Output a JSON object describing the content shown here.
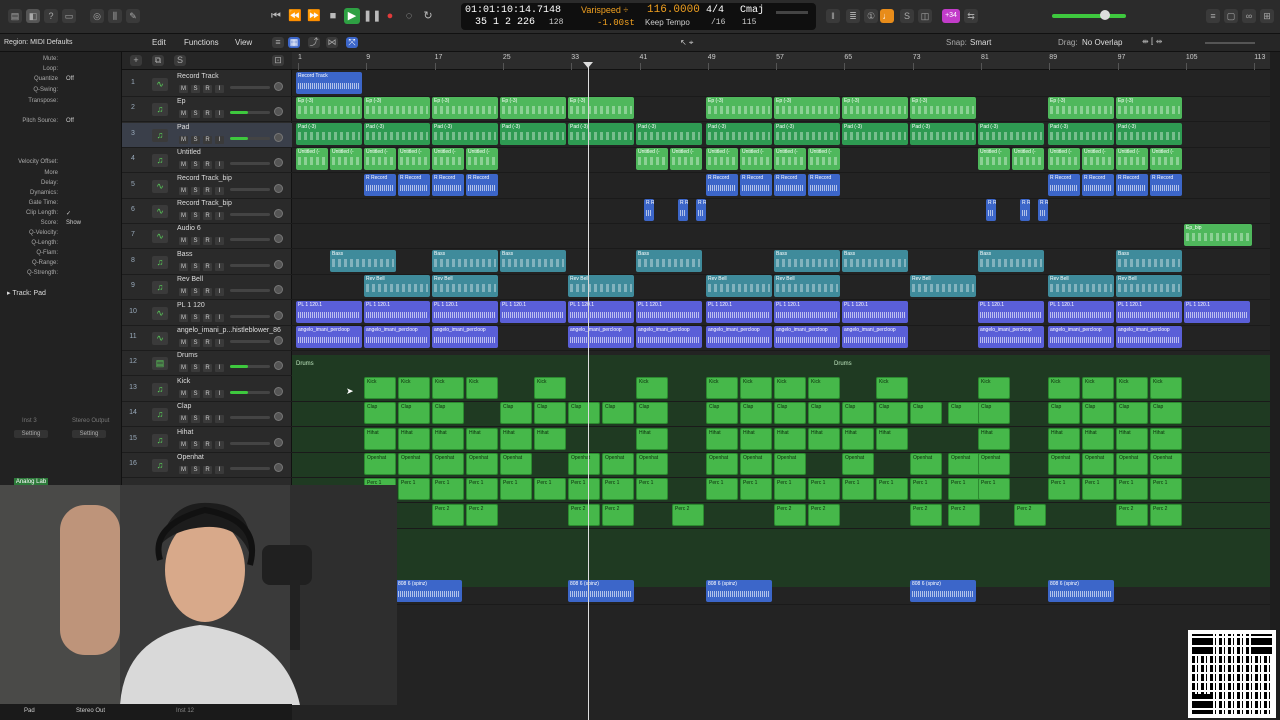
{
  "lcd": {
    "time": "01:01:10:14.71",
    "bars": "35  1  2  226",
    "div": "48",
    "div2": "128",
    "varispeed": "Varispeed ÷",
    "varispeed_val": "-1.00st",
    "tempo": "116.0000",
    "keep_tempo": "Keep Tempo",
    "sig": "4/4",
    "sig_div": "/16",
    "key": "Cmaj",
    "key_val": "115"
  },
  "toolbar": {
    "region_label": "Region: MIDI Defaults",
    "edit": "Edit",
    "functions": "Functions",
    "view": "View",
    "snap_label": "Snap:",
    "snap_value": "Smart",
    "drag_label": "Drag:",
    "drag_value": "No Overlap",
    "badge": "+34"
  },
  "inspector": {
    "rows": [
      {
        "label": "Mute:",
        "value": ""
      },
      {
        "label": "Loop:",
        "value": ""
      },
      {
        "label": "Quantize",
        "value": "Off"
      },
      {
        "label": "Q-Swing:",
        "value": ""
      },
      {
        "label": "Transpose:",
        "value": ""
      },
      {
        "label": "Pitch Source:",
        "value": "Off"
      },
      {
        "label": "Velocity Offset:",
        "value": ""
      },
      {
        "label": "More",
        "value": ""
      },
      {
        "label": "Delay:",
        "value": ""
      },
      {
        "label": "Dynamics:",
        "value": ""
      },
      {
        "label": "Gate Time:",
        "value": ""
      },
      {
        "label": "Clip Length:",
        "value": "✓"
      },
      {
        "label": "Score:",
        "value": "Show"
      },
      {
        "label": "Q-Velocity:",
        "value": ""
      },
      {
        "label": "Q-Length:",
        "value": ""
      },
      {
        "label": "Q-Flam:",
        "value": ""
      },
      {
        "label": "Q-Range:",
        "value": ""
      },
      {
        "label": "Q-Strength:",
        "value": ""
      }
    ],
    "track_label": "Track:",
    "track_value": "Pad",
    "setting1": "Setting",
    "setting2": "Setting",
    "insert": "Inst 3",
    "stereo_out": "Stereo Output",
    "plugin": "Analog Lab"
  },
  "tracks": [
    {
      "num": "1",
      "name": "Record Track",
      "icon": "waveform-icon"
    },
    {
      "num": "2",
      "name": "Ep",
      "icon": "midi-note-icon"
    },
    {
      "num": "3",
      "name": "Pad",
      "icon": "midi-note-icon"
    },
    {
      "num": "4",
      "name": "Untitled",
      "icon": "midi-note-icon"
    },
    {
      "num": "5",
      "name": "Record Track_bip",
      "icon": "waveform-icon"
    },
    {
      "num": "6",
      "name": "Record Track_bip",
      "icon": "waveform-icon"
    },
    {
      "num": "7",
      "name": "Audio 6",
      "icon": "waveform-icon"
    },
    {
      "num": "8",
      "name": "Bass",
      "icon": "midi-note-icon"
    },
    {
      "num": "9",
      "name": "Rev Bell",
      "icon": "midi-note-icon"
    },
    {
      "num": "10",
      "name": "PL 1 120",
      "icon": "waveform-icon"
    },
    {
      "num": "11",
      "name": "angelo_imani_p...histleblower_86",
      "icon": "waveform-icon"
    },
    {
      "num": "12",
      "name": "Drums",
      "icon": "folder-icon"
    },
    {
      "num": "13",
      "name": "Kick",
      "icon": "midi-note-icon"
    },
    {
      "num": "14",
      "name": "Clap",
      "icon": "midi-note-icon"
    },
    {
      "num": "15",
      "name": "Hihat",
      "icon": "midi-note-icon"
    },
    {
      "num": "16",
      "name": "Openhat",
      "icon": "midi-note-icon"
    }
  ],
  "ruler": [
    "1",
    "9",
    "17",
    "25",
    "33",
    "41",
    "49",
    "57",
    "65",
    "73",
    "81",
    "89",
    "97",
    "105",
    "113"
  ],
  "lanes": {
    "drums_label": "Drums",
    "drums_label2": "Drums",
    "record_track": "Record Track",
    "ep": "Ep (-3)",
    "pad": "Pad (-3)",
    "untitled": "Untitled (-",
    "rec": "R Record",
    "bass": "Bass",
    "revbell": "Rev Bell",
    "pl": "PL 1 120.1",
    "angelo": "angelo_imani_percloop",
    "epbip": "Ep_bip",
    "kick": "Kick",
    "clap": "Clap",
    "hihat": "Hihat",
    "openhat": "Openhat",
    "perc1": "Perc 1",
    "perc2": "Perc 2",
    "b808": "808 6 (spinz)"
  },
  "bottom": {
    "left": "Pad",
    "right": "Stereo Out",
    "inst": "Inst 12"
  },
  "colors": {
    "accent": "#3ec83e",
    "drum_region": "#46b84a",
    "audio_region": "#3c66c9",
    "playhead": "#dddddd"
  }
}
